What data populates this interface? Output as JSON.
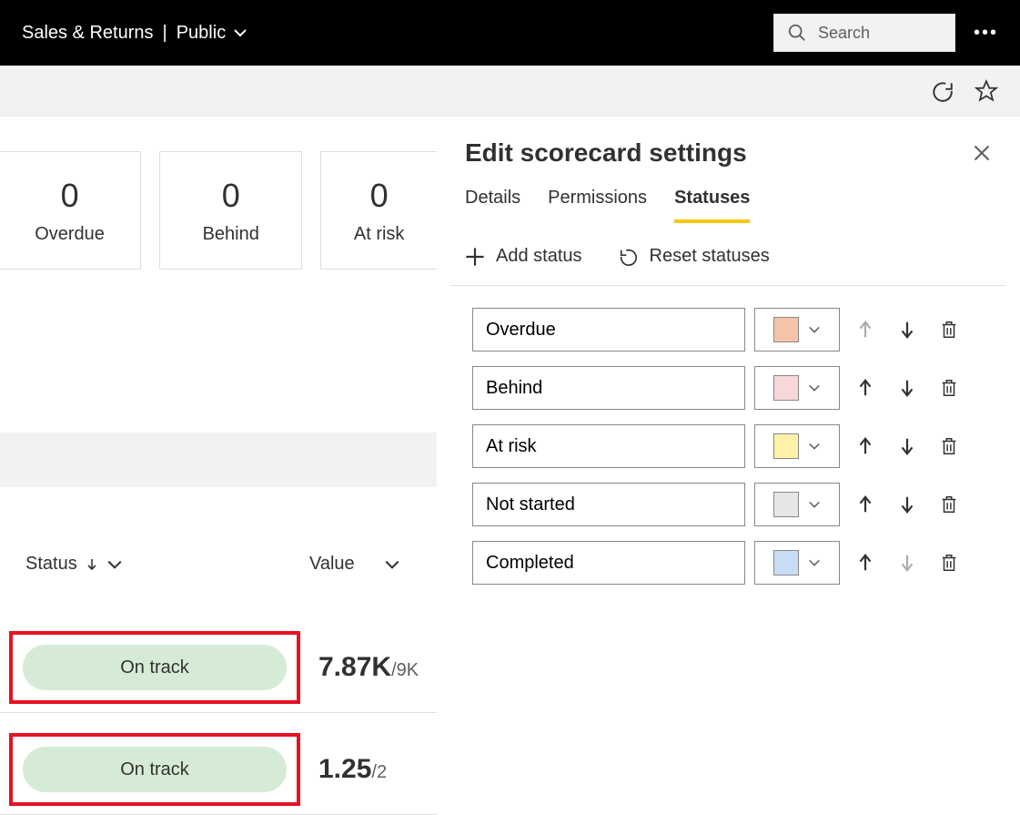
{
  "header": {
    "app_title": "Sales & Returns",
    "scope": "Public",
    "search_placeholder": "Search"
  },
  "cards": [
    {
      "value": "0",
      "label": "Overdue"
    },
    {
      "value": "0",
      "label": "Behind"
    },
    {
      "value": "0",
      "label": "At risk"
    }
  ],
  "table": {
    "columns": {
      "status": "Status",
      "value": "Value"
    },
    "rows": [
      {
        "status": "On track",
        "value": "7.87K",
        "target": "/9K"
      },
      {
        "status": "On track",
        "value": "1.25",
        "target": "/2"
      }
    ]
  },
  "panel": {
    "title": "Edit scorecard settings",
    "tabs": {
      "details": "Details",
      "permissions": "Permissions",
      "statuses": "Statuses"
    },
    "actions": {
      "add": "Add status",
      "reset": "Reset statuses"
    },
    "statuses": [
      {
        "name": "Overdue",
        "color": "#f4c3a8",
        "up_disabled": true,
        "down_disabled": false
      },
      {
        "name": "Behind",
        "color": "#f8d7da",
        "up_disabled": false,
        "down_disabled": false
      },
      {
        "name": "At risk",
        "color": "#fff2a8",
        "up_disabled": false,
        "down_disabled": false
      },
      {
        "name": "Not started",
        "color": "#e6e6e6",
        "up_disabled": false,
        "down_disabled": false
      },
      {
        "name": "Completed",
        "color": "#c7ddf5",
        "up_disabled": false,
        "down_disabled": true
      }
    ]
  }
}
